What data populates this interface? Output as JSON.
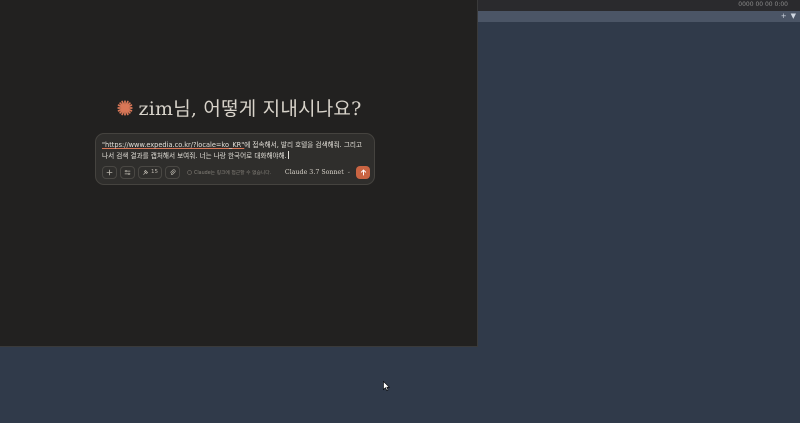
{
  "system": {
    "topbar_label": "0000 00 00 0:00"
  },
  "desktop": {
    "controls": [
      "+",
      "▼"
    ]
  },
  "greeting": {
    "text": "zim님, 어떻게 지내시나요?"
  },
  "composer": {
    "prompt_url": "\"https://www.expedia.co.kr/?locale=ko_KR\"",
    "prompt_rest": "에 접속해서, 발리 호텔을 검색해줘. 그리고 나서 검색 결과를 캡처해서 보여줘. 너는 나랑 한국어로 대화해야해.",
    "tools_count": "15",
    "hint": "Claude는 링크에 접근할 수 없습니다.",
    "model": "Claude 3.7 Sonnet"
  },
  "colors": {
    "accent": "#c96442",
    "window_bg": "#222120",
    "desktop_bg": "#313b4b"
  }
}
